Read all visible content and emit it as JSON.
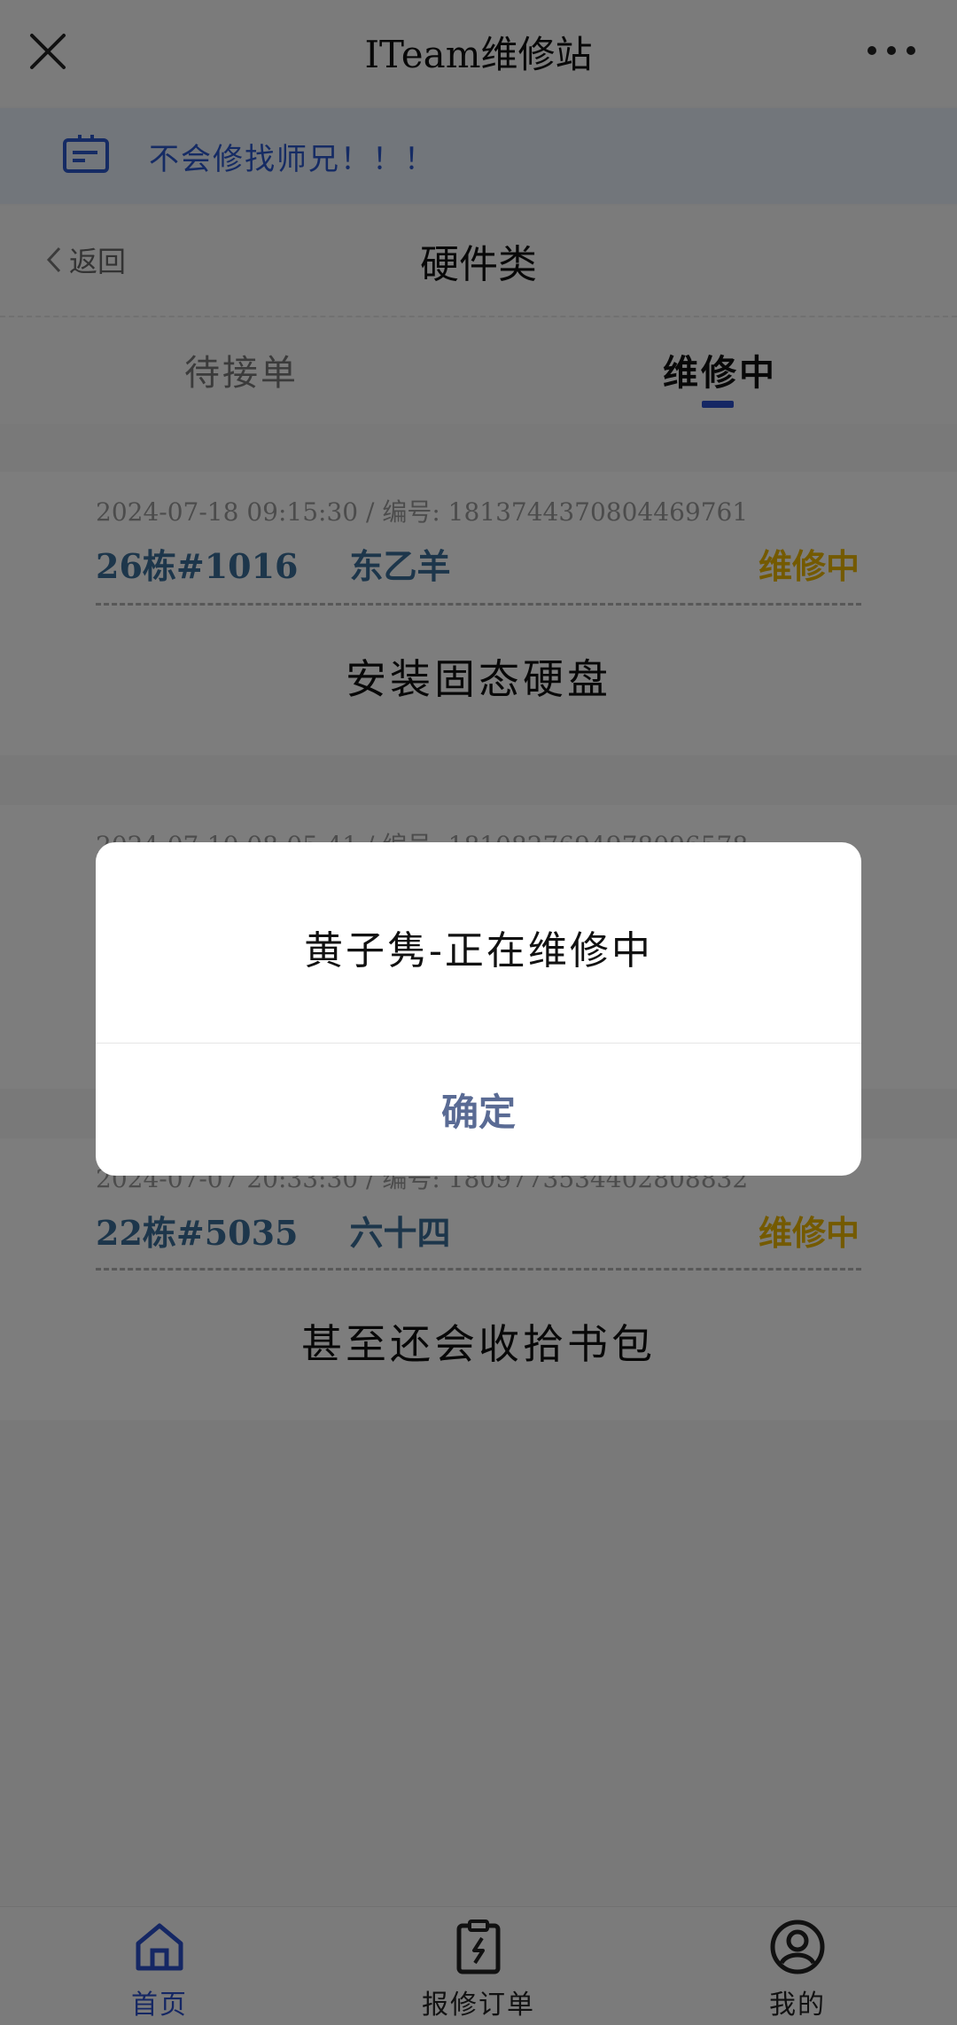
{
  "header": {
    "title": "ITeam维修站"
  },
  "notice": {
    "text": "不会修找师兄！！！"
  },
  "subheader": {
    "back_label": "返回",
    "title": "硬件类"
  },
  "tabs": [
    {
      "label": "待接单",
      "active": false
    },
    {
      "label": "维修中",
      "active": true
    }
  ],
  "orders": [
    {
      "meta": "2024-07-18 09:15:30   /   编号: 1813744370804469761",
      "location": "26栋#1016",
      "name": "东乙羊",
      "status": "维修中",
      "description": "安装固态硬盘"
    },
    {
      "meta": "2024-07-10 08:05:41   /   编号: 1810827694978096578",
      "location": "",
      "name": "",
      "status": "",
      "description": ""
    },
    {
      "meta": "2024-07-07 20:33:30   /   编号: 1809773534402808832",
      "location": "22栋#5035",
      "name": "六十四",
      "status": "维修中",
      "description": "甚至还会收拾书包"
    }
  ],
  "bottom_nav": [
    {
      "label": "首页",
      "icon": "home-icon",
      "active": true
    },
    {
      "label": "报修订单",
      "icon": "repair-order-icon",
      "active": false
    },
    {
      "label": "我的",
      "icon": "profile-icon",
      "active": false
    }
  ],
  "dialog": {
    "message": "黄子隽-正在维修中",
    "confirm_label": "确定"
  },
  "colors": {
    "accent_blue": "#2a4fc8",
    "status_yellow": "#e8b400",
    "address_blue": "#3a6d96",
    "overlay": "rgba(0,0,0,0.5)"
  }
}
